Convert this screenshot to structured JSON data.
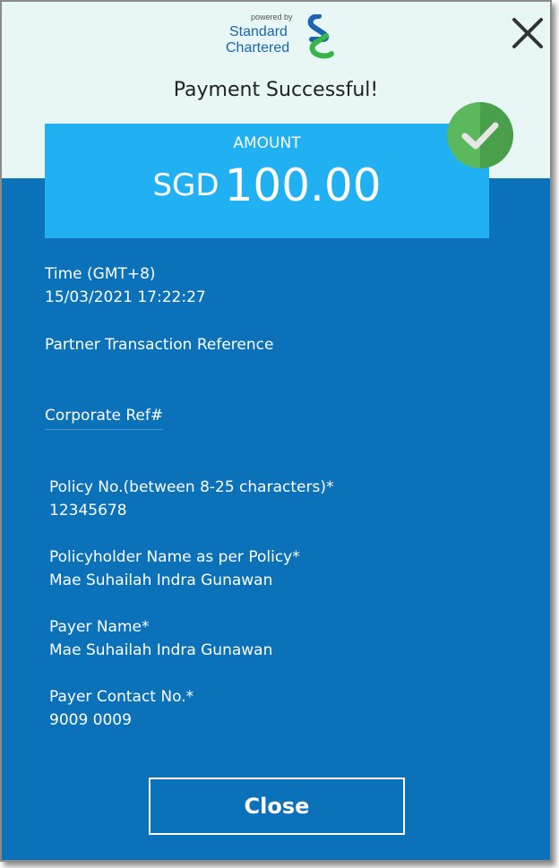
{
  "brand": {
    "powered_by": "powered by",
    "name_line1": "Standard",
    "name_line2": "Chartered"
  },
  "title": "Payment Successful!",
  "amount": {
    "label": "AMOUNT",
    "currency": "SGD",
    "value": "100.00"
  },
  "fields": [
    {
      "label": "Time (GMT+8)",
      "value": "15/03/2021 17:22:27"
    },
    {
      "label": "Partner Transaction Reference",
      "value": ""
    },
    {
      "label": "Corporate Ref#",
      "value": ""
    },
    {
      "label": "Policy No.(between 8-25 characters)*",
      "value": "12345678"
    },
    {
      "label": "Policyholder Name as per Policy*",
      "value": "Mae Suhailah Indra Gunawan"
    },
    {
      "label": "Payer Name*",
      "value": "Mae Suhailah Indra Gunawan"
    },
    {
      "label": "Payer Contact No.*",
      "value": "9009 0009"
    }
  ],
  "close_button": "Close",
  "colors": {
    "panel_blue": "#0b72b9",
    "amount_blue": "#21b1f3",
    "header_mint": "#e8f7f6",
    "success_green": "#5cb85c"
  },
  "icons": {
    "close": "close-x-icon",
    "success": "checkmark-icon",
    "logo": "standard-chartered-logo-icon"
  }
}
